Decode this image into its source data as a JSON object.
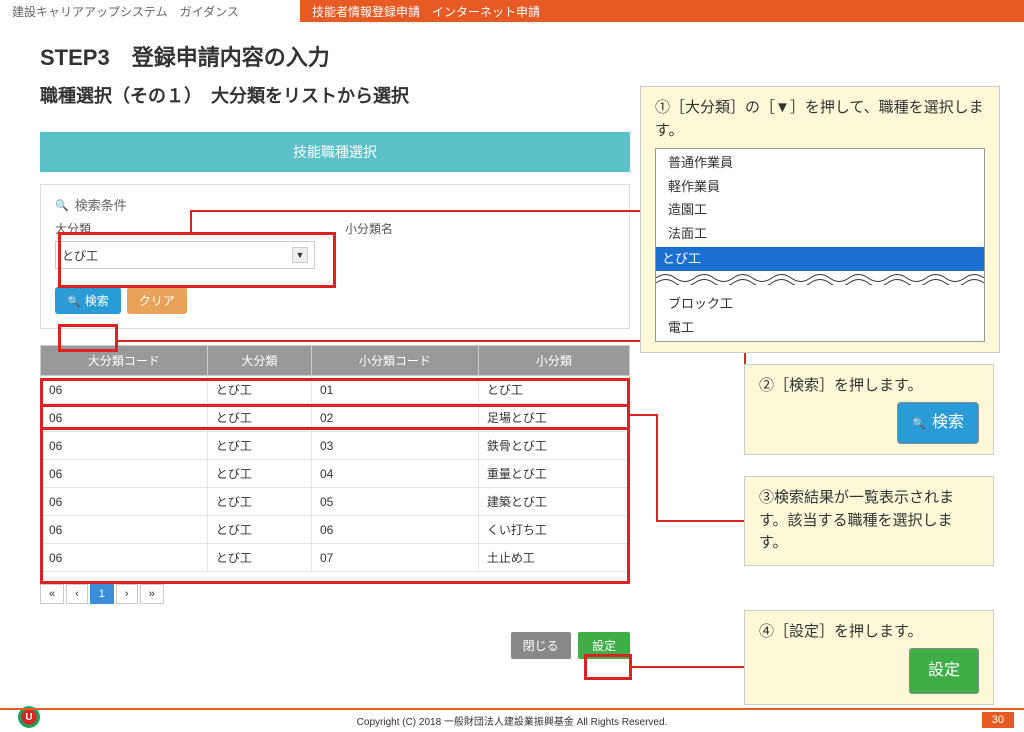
{
  "topbar": {
    "left": "建設キャリアアップシステム　ガイダンス",
    "right": "技能者情報登録申請　インターネット申請"
  },
  "step_title": "STEP3　登録申請内容の入力",
  "subtitle": "職種選択（その１）　大分類をリストから選択",
  "modal": {
    "header": "技能職種選択",
    "search_cond_label": "検索条件",
    "field_major": "大分類",
    "field_minor": "小分類名",
    "select_value": "とび工",
    "btn_search": "検索",
    "btn_clear": "クリア",
    "btn_close": "閉じる",
    "btn_set": "設定"
  },
  "table": {
    "headers": [
      "大分類コード",
      "大分類",
      "小分類コード",
      "小分類"
    ],
    "rows": [
      [
        "06",
        "とび工",
        "01",
        "とび工"
      ],
      [
        "06",
        "とび工",
        "02",
        "足場とび工"
      ],
      [
        "06",
        "とび工",
        "03",
        "鉄骨とび工"
      ],
      [
        "06",
        "とび工",
        "04",
        "重量とび工"
      ],
      [
        "06",
        "とび工",
        "05",
        "建築とび工"
      ],
      [
        "06",
        "とび工",
        "06",
        "くい打ち工"
      ],
      [
        "06",
        "とび工",
        "07",
        "土止め工"
      ]
    ]
  },
  "pagination": {
    "first": "«",
    "prev": "‹",
    "page": "1",
    "next": "›",
    "last": "»"
  },
  "callouts": {
    "c1_text": "①［大分類］の［▼］を押して、職種を選択します。",
    "c2_text": "②［検索］を押します。",
    "c2_btn": "検索",
    "c3_text": "③検索結果が一覧表示されます。該当する職種を選択します。",
    "c4_text": "④［設定］を押します。",
    "c4_btn": "設定"
  },
  "dropdown": {
    "items_top": [
      "普通作業員",
      "軽作業員",
      "造園工",
      "法面工"
    ],
    "selected": "とび工",
    "items_bottom": [
      "ブロック工",
      "電工"
    ]
  },
  "footer": {
    "copyright": "Copyright (C) 2018 一般財団法人建設業振興基金 All Rights Reserved.",
    "page": "30"
  }
}
